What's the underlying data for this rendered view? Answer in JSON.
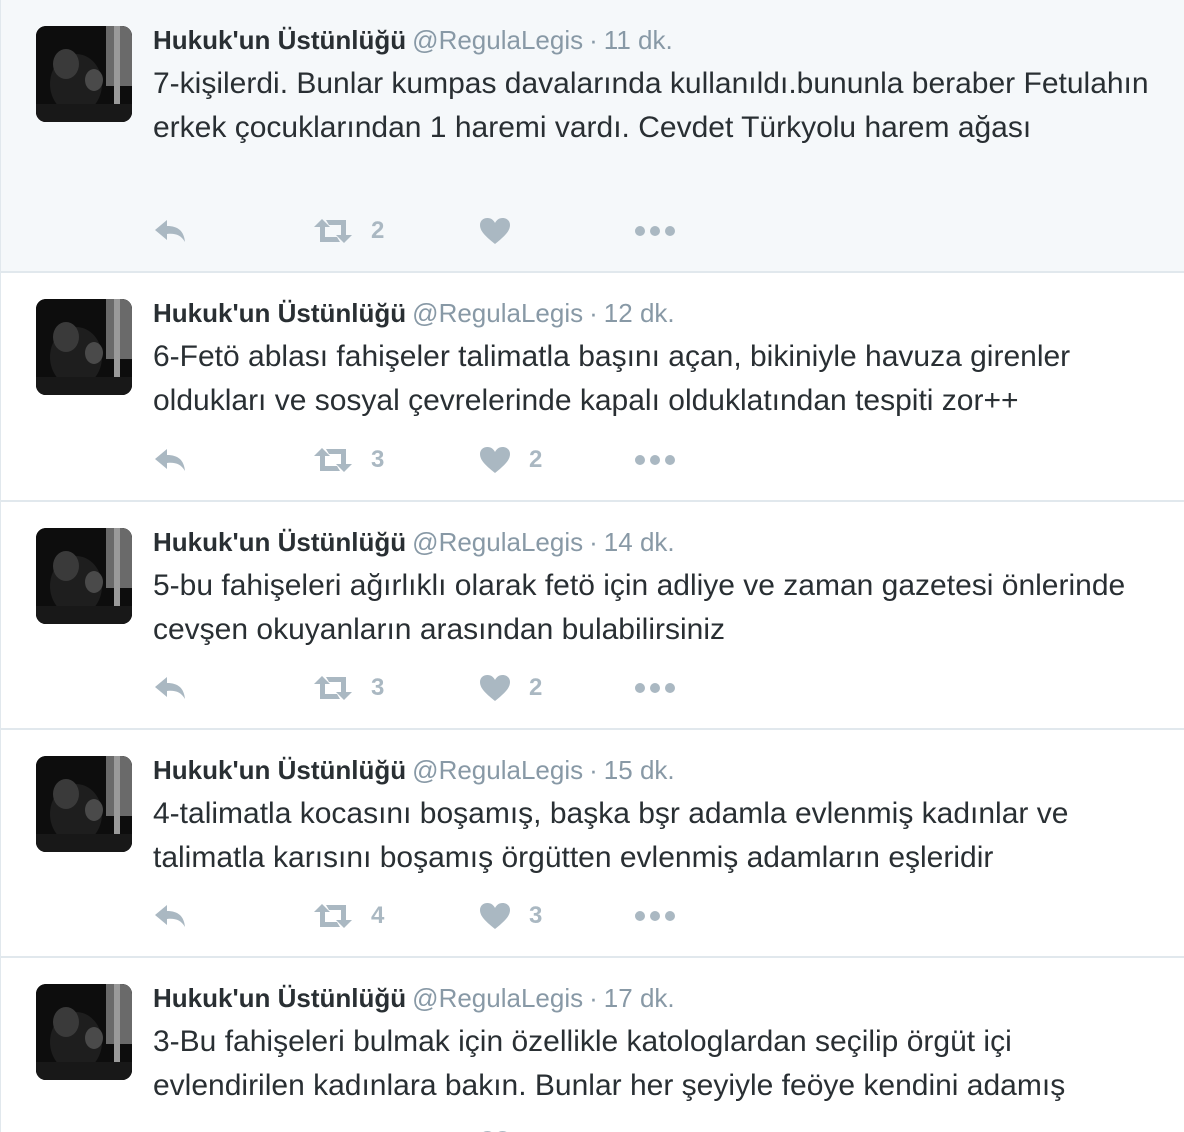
{
  "tweets": [
    {
      "name": "Hukuk'un Üstünlüğü",
      "handle": "@RegulaLegis",
      "separator": "·",
      "time": "11 dk.",
      "text": "7-kişilerdi. Bunlar kumpas davalarında kullanıldı.bununla beraber Fetulahın erkek çocuklarından 1 haremi vardı. Cevdet Türkyolu harem ağası",
      "retweets": "2",
      "likes": ""
    },
    {
      "name": "Hukuk'un Üstünlüğü",
      "handle": "@RegulaLegis",
      "separator": "·",
      "time": "12 dk.",
      "text": "6-Fetö ablası fahişeler talimatla başını açan, bikiniyle havuza girenler oldukları ve sosyal çevrelerinde kapalı olduklatından tespiti zor++",
      "retweets": "3",
      "likes": "2"
    },
    {
      "name": "Hukuk'un Üstünlüğü",
      "handle": "@RegulaLegis",
      "separator": "·",
      "time": "14 dk.",
      "text": "5-bu fahişeleri ağırlıklı olarak fetö için adliye ve zaman gazetesi önlerinde cevşen okuyanların arasından bulabilirsiniz",
      "retweets": "3",
      "likes": "2"
    },
    {
      "name": "Hukuk'un Üstünlüğü",
      "handle": "@RegulaLegis",
      "separator": "·",
      "time": "15 dk.",
      "text": "4-talimatla kocasını boşamış, başka bşr adamla evlenmiş kadınlar ve talimatla karısını boşamış örgütten evlenmiş adamların eşleridir",
      "retweets": "4",
      "likes": "3"
    },
    {
      "name": "Hukuk'un Üstünlüğü",
      "handle": "@RegulaLegis",
      "separator": "·",
      "time": "17 dk.",
      "text": "3-Bu fahişeleri bulmak için özellikle katologlardan seçilip örgüt içi evlendirilen kadınlara bakın. Bunlar her şeyiyle feöye kendini adamış",
      "retweets": "",
      "likes": ""
    }
  ],
  "icons": {
    "reply": "reply-icon",
    "retweet": "retweet-icon",
    "like": "heart-icon",
    "more": "more-dots-icon"
  },
  "colors": {
    "name": "#292f33",
    "meta": "#8899a6",
    "action": "#aab8c2",
    "highlight_bg": "#f5f8fa",
    "divider": "#e1e8ed"
  }
}
